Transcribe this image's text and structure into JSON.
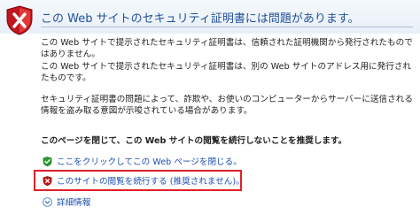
{
  "header": {
    "title": "この Web サイトのセキュリティ証明書には問題があります。",
    "shield_icon": "shield-x-icon"
  },
  "body": {
    "paragraph_1": "この Web サイトで提示されたセキュリティ証明書は、信頼された証明機関から発行されたものではありません。",
    "paragraph_2": "この Web サイトで提示されたセキュリティ証明書は、別の Web サイトのアドレス用に発行されたものです。",
    "paragraph_3": "セキュリティ証明書の問題によって、詐欺や、お使いのコンピューターからサーバーに送信される情報を盗み取る意図が示唆されている場合があります。",
    "recommendation": "このページを閉じて、この Web サイトの閲覧を続行しないことを推奨します。"
  },
  "actions": {
    "close_page_label": "ここをクリックしてこの Web ページを閉じる。",
    "close_page_icon": "green-check-shield-icon",
    "continue_label": "このサイトの閲覧を続行する (推奨されません)。",
    "continue_icon": "red-x-shield-icon",
    "details_label": "詳細情報",
    "details_icon": "chevron-down-circle-icon"
  },
  "colors": {
    "title": "#1f4f9a",
    "link": "#1c4fb0",
    "highlight": "#e0202a"
  }
}
